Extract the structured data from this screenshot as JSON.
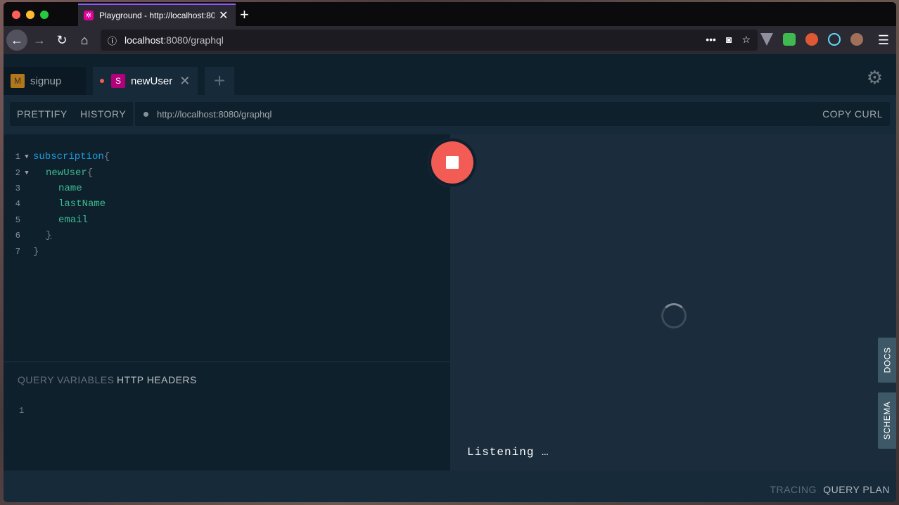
{
  "browser": {
    "tab_title": "Playground - http://localhost:8080/graphql",
    "url_host": "localhost",
    "url_rest": ":8080/graphql"
  },
  "icons": {
    "back": "←",
    "forward": "→",
    "reload": "↻",
    "home": "⌂",
    "info": "ⓘ",
    "more": "•••",
    "pocket": "◙",
    "star": "☆",
    "new_tab": "+",
    "close": "✕",
    "menu": "☰",
    "settings": "⚙",
    "add": "+"
  },
  "playground": {
    "tabs": [
      {
        "badge": "M",
        "label": "signup"
      },
      {
        "badge": "S",
        "label": "newUser"
      }
    ],
    "toolbar": {
      "prettify": "PRETTIFY",
      "history": "HISTORY",
      "endpoint": "http://localhost:8080/graphql",
      "copy_curl": "COPY CURL"
    },
    "editor_lines": [
      {
        "n": "1",
        "text": "subscription",
        "suffix": " {"
      },
      {
        "n": "2",
        "text": "newUser",
        "suffix": " {"
      },
      {
        "n": "3",
        "text": "name"
      },
      {
        "n": "4",
        "text": "lastName"
      },
      {
        "n": "5",
        "text": "email"
      },
      {
        "n": "6",
        "text": "}"
      },
      {
        "n": "7",
        "text": "}"
      }
    ],
    "vars": {
      "query_variables": "QUERY VARIABLES",
      "http_headers": "HTTP HEADERS",
      "line": "1"
    },
    "result": {
      "status": "Listening …",
      "docs": "DOCS",
      "schema": "SCHEMA"
    },
    "footer": {
      "tracing": "TRACING",
      "query_plan": "QUERY PLAN"
    }
  },
  "colors": {
    "accent_run": "#f25c54",
    "mutation_badge": "#b3771b",
    "subscription_badge": "#b1007a",
    "keyword": "#1e9cd9",
    "field": "#3bbb8f"
  }
}
